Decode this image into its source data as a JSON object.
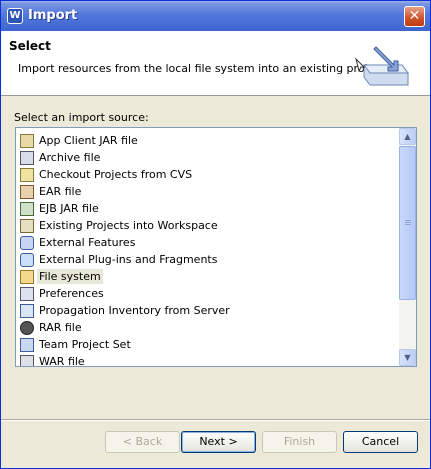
{
  "window": {
    "title": "Import",
    "close_symbol": "✕"
  },
  "header": {
    "title": "Select",
    "description": "Import resources from the local file system into an existing project."
  },
  "list": {
    "prompt": "Select an import source:",
    "items": [
      {
        "label": "App Client JAR file",
        "icon": "jar-icon"
      },
      {
        "label": "Archive file",
        "icon": "archive-icon"
      },
      {
        "label": "Checkout Projects from CVS",
        "icon": "cvs-icon"
      },
      {
        "label": "EAR file",
        "icon": "ear-icon"
      },
      {
        "label": "EJB JAR file",
        "icon": "ejb-icon"
      },
      {
        "label": "Existing Projects into Workspace",
        "icon": "project-icon"
      },
      {
        "label": "External Features",
        "icon": "feature-icon"
      },
      {
        "label": "External Plug-ins and Fragments",
        "icon": "plugin-icon"
      },
      {
        "label": "File system",
        "icon": "folder-icon",
        "selected": true
      },
      {
        "label": "Preferences",
        "icon": "preferences-icon"
      },
      {
        "label": "Propagation Inventory from Server",
        "icon": "inventory-icon"
      },
      {
        "label": "RAR file",
        "icon": "rar-icon"
      },
      {
        "label": "Team Project Set",
        "icon": "team-icon"
      },
      {
        "label": "WAR file",
        "icon": "war-icon"
      }
    ]
  },
  "scrollbar": {
    "up_symbol": "▲",
    "down_symbol": "▼"
  },
  "buttons": {
    "back": "< Back",
    "next": "Next >",
    "finish": "Finish",
    "cancel": "Cancel"
  },
  "colors": {
    "titlebar": "#0a246a",
    "accent": "#316ac5",
    "selection": "#e8e8d8"
  }
}
